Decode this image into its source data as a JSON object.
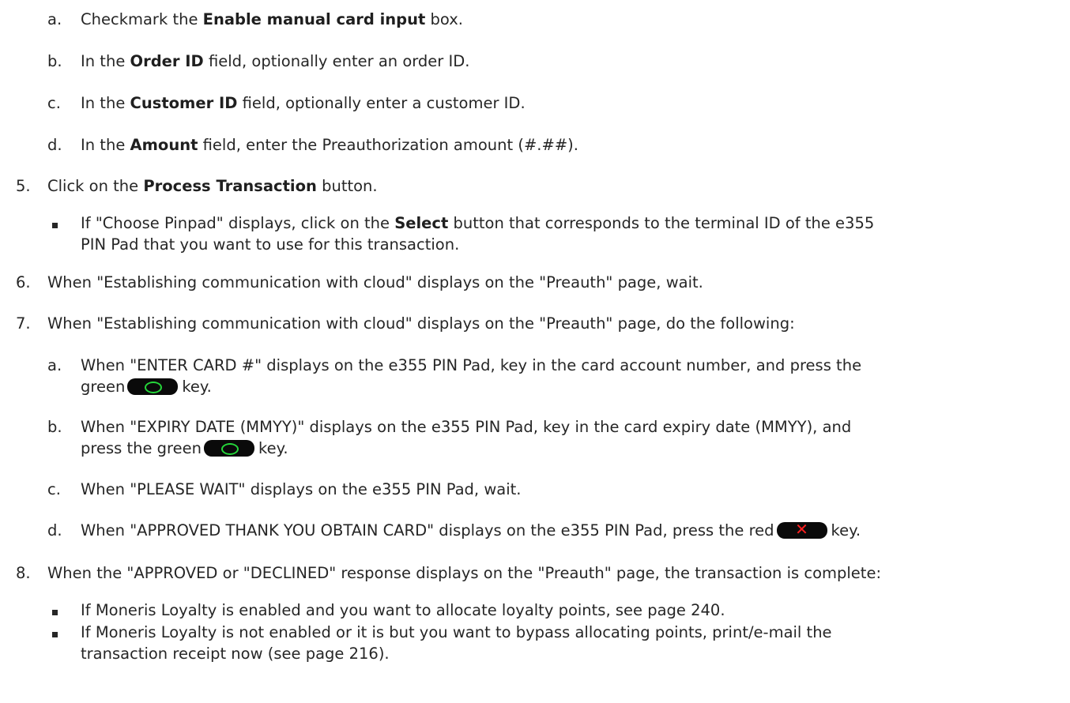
{
  "steps": [
    {
      "id": "4a",
      "marker": "a.",
      "parts": [
        [
          "Checkmark the ",
          false
        ],
        [
          "Enable manual card input",
          true
        ],
        [
          " box.",
          false
        ]
      ]
    },
    {
      "id": "4b",
      "marker": "b.",
      "parts": [
        [
          "In the ",
          false
        ],
        [
          "Order ID",
          true
        ],
        [
          " field, optionally enter an order ID.",
          false
        ]
      ]
    },
    {
      "id": "4c",
      "marker": "c.",
      "parts": [
        [
          "In the ",
          false
        ],
        [
          "Customer ID",
          true
        ],
        [
          " field, optionally enter a customer ID.",
          false
        ]
      ]
    },
    {
      "id": "4d",
      "marker": "d.",
      "parts": [
        [
          "In the ",
          false
        ],
        [
          "Amount",
          true
        ],
        [
          " field, enter the Preauthorization amount (#.##).",
          false
        ]
      ]
    },
    {
      "id": "5",
      "marker": "5.",
      "parts": [
        [
          "Click on the ",
          false
        ],
        [
          "Process Transaction",
          true
        ],
        [
          " button.",
          false
        ]
      ]
    },
    {
      "id": "5-bullet",
      "marker": "",
      "parts": [
        [
          "If \"Choose Pinpad\" displays, click on the ",
          false
        ],
        [
          "Select",
          true
        ],
        [
          " button that corresponds to the terminal ID of the e355",
          false
        ]
      ],
      "cont": "PIN Pad that you want to use for this transaction."
    },
    {
      "id": "6",
      "marker": "6.",
      "parts": [
        [
          "When \"Establishing communication with cloud\" displays on the \"Preauth\" page, wait.",
          false
        ]
      ]
    },
    {
      "id": "7",
      "marker": "7.",
      "parts": [
        [
          "When \"Establishing communication with cloud\" displays on the \"Preauth\" page, do the following:",
          false
        ]
      ]
    },
    {
      "id": "7a",
      "marker": "a.",
      "parts": [
        [
          "When \"ENTER CARD #\" displays on the e355 PIN Pad, key in the card account number, and press the",
          false
        ]
      ],
      "cont_before": "green",
      "cont_key": "green-o",
      "cont_after": "key."
    },
    {
      "id": "7b",
      "marker": "b.",
      "parts": [
        [
          "When \"EXPIRY DATE (MMYY)\" displays on the e355 PIN Pad, key in the card expiry date (MMYY), and",
          false
        ]
      ],
      "cont_before": "press the green",
      "cont_key": "green-o",
      "cont_after": "key."
    },
    {
      "id": "7c",
      "marker": "c.",
      "parts": [
        [
          "When \"PLEASE WAIT\" displays on the e355 PIN Pad, wait.",
          false
        ]
      ]
    },
    {
      "id": "7d",
      "marker": "d.",
      "parts": [
        [
          "When \"APPROVED THANK YOU OBTAIN CARD\" displays on the e355 PIN Pad, press the red",
          false
        ]
      ],
      "inline_key": "red-x",
      "after_key": "key."
    },
    {
      "id": "8",
      "marker": "8.",
      "parts": [
        [
          "When the \"APPROVED or \"DECLINED\" response displays on the \"Preauth\" page, the transaction is complete:",
          false
        ]
      ]
    },
    {
      "id": "8-bullet-1",
      "marker": "",
      "parts": [
        [
          "If Moneris Loyalty is enabled and you want to allocate loyalty points, see page 240.",
          false
        ]
      ]
    },
    {
      "id": "8-bullet-2",
      "marker": "",
      "parts": [
        [
          "If Moneris Loyalty is not enabled or it is but you want to bypass allocating points, print/e-mail the",
          false
        ]
      ],
      "cont": "transaction receipt now (see page 216)."
    }
  ],
  "key_icons": {
    "green-o": {
      "name": "green-o-key-icon",
      "glyph_color": "#25d63a"
    },
    "red-x": {
      "name": "red-x-key-icon",
      "glyph": "✕",
      "glyph_color": "#ff1f1f"
    }
  }
}
